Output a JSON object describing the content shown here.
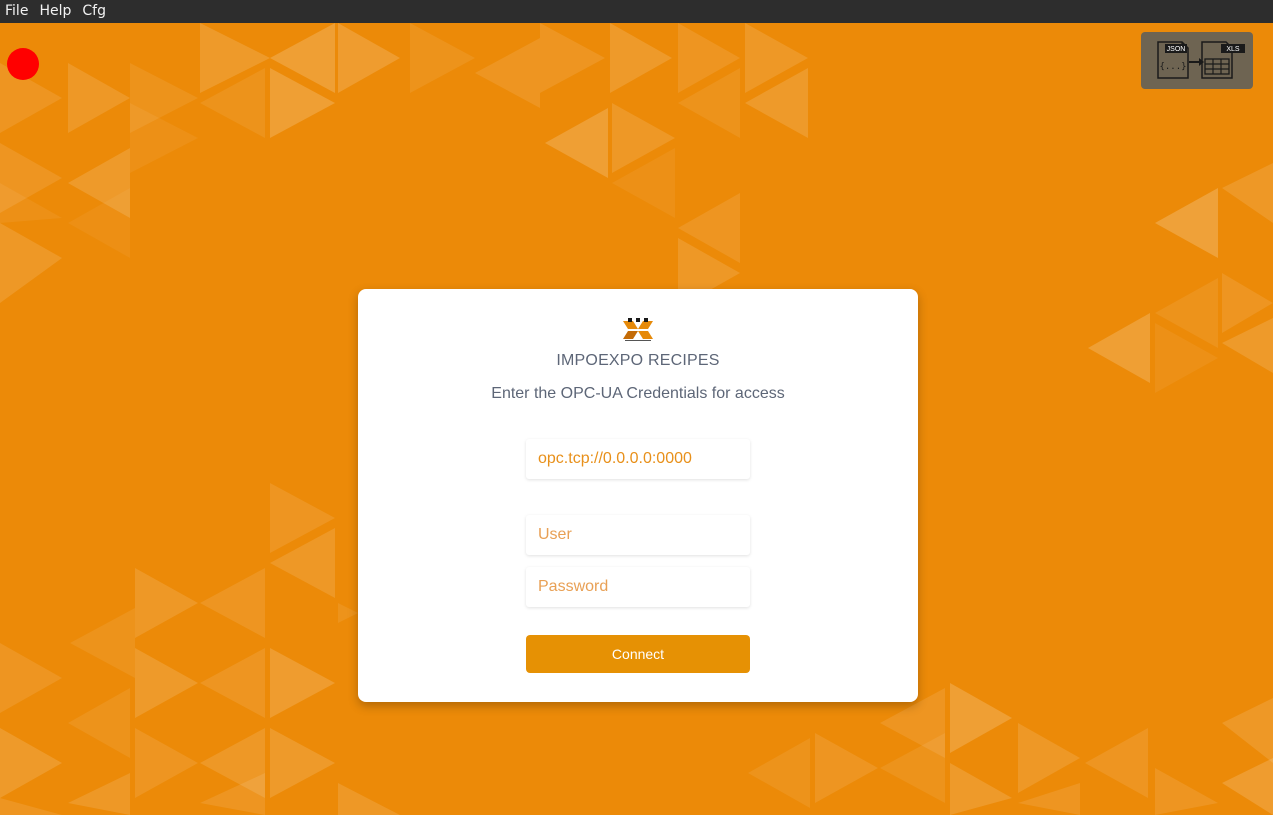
{
  "menu": {
    "items": [
      "File",
      "Help",
      "Cfg"
    ]
  },
  "status": {
    "icon": "connection-status-dot",
    "color": "#ff0000"
  },
  "converter": {
    "icon": "json-to-xls-icon",
    "source_label": "JSON",
    "target_label": "XLS",
    "source_glyph": "{...}"
  },
  "login": {
    "logo": "tmg-logo",
    "title": "IMPOEXPO RECIPES",
    "subtitle": "Enter the OPC-UA Credentials for access",
    "server_value": "opc.tcp://0.0.0.0:0000",
    "user_placeholder": "User",
    "password_placeholder": "Password",
    "connect_label": "Connect"
  },
  "colors": {
    "background": "#ec8a08",
    "accent": "#e69104",
    "menubar": "#2d2d2d",
    "text": "#5d6677"
  }
}
